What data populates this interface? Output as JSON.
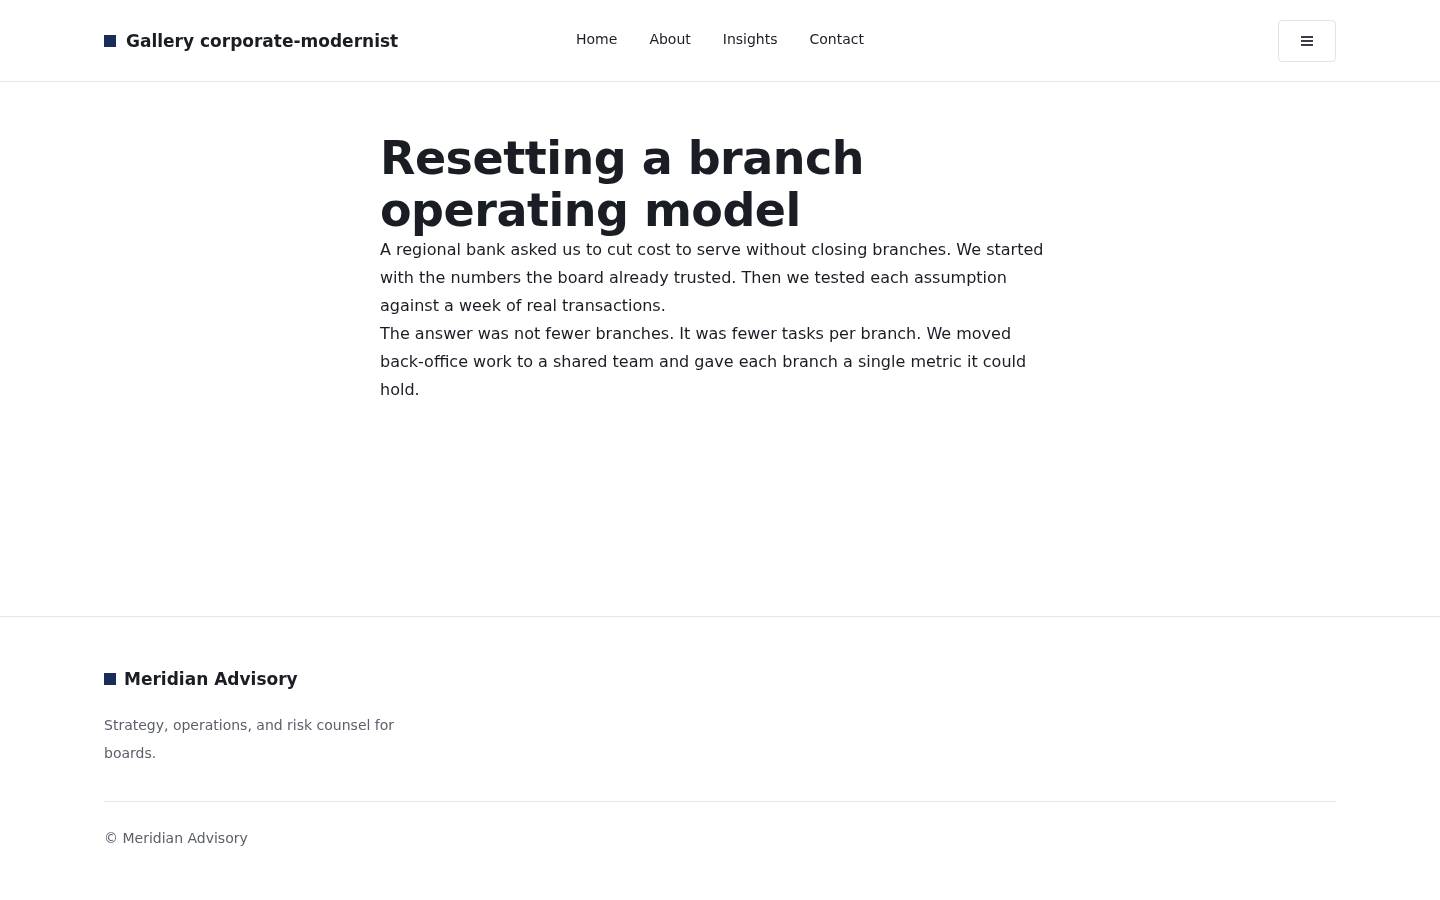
{
  "header": {
    "brand": "Gallery corporate-modernist",
    "nav": [
      {
        "label": "Home"
      },
      {
        "label": "About"
      },
      {
        "label": "Insights"
      },
      {
        "label": "Contact"
      }
    ]
  },
  "article": {
    "title": "Resetting a branch operating model",
    "paragraphs": [
      "A regional bank asked us to cut cost to serve without closing branches. We started with the numbers the board already trusted. Then we tested each assumption against a week of real transactions.",
      "The answer was not fewer branches. It was fewer tasks per branch. We moved back-office work to a shared team and gave each branch a single metric it could hold."
    ]
  },
  "footer": {
    "brand": "Meridian Advisory",
    "tagline": "Strategy, operations, and risk counsel for boards.",
    "copyright": "© Meridian Advisory"
  }
}
